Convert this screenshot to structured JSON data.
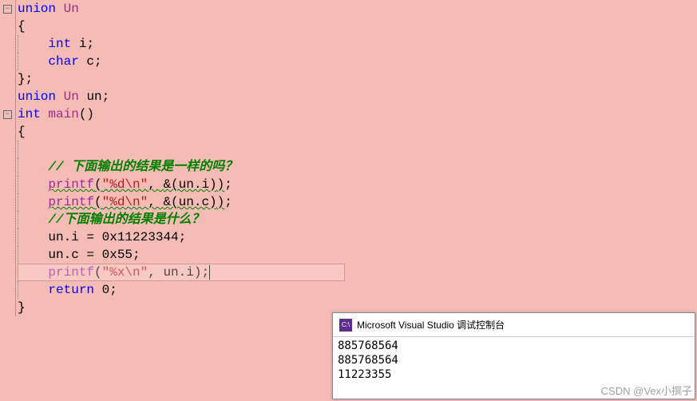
{
  "code": {
    "l1": {
      "kw1": "union",
      "id": "Un"
    },
    "l2": "{",
    "l3": {
      "kw": "int",
      "id": "i"
    },
    "l4": {
      "kw": "char",
      "id": "c"
    },
    "l5": "};",
    "l6": {
      "kw": "union",
      "ty": "Un",
      "id": "un"
    },
    "l7": {
      "kw": "int",
      "fn": "main",
      "paren": "()"
    },
    "l8": "{",
    "l9": "",
    "l10": "// 下面输出的结果是一样的吗？",
    "l11": {
      "fn": "printf",
      "str": "\"%d\\n\"",
      "expr": "&(un.i)"
    },
    "l12": {
      "fn": "printf",
      "str": "\"%d\\n\"",
      "expr": "&(un.c)"
    },
    "l13": "//下面输出的结果是什么？",
    "l14": {
      "left": "un.i",
      "val": "0x11223344"
    },
    "l15": {
      "left": "un.c",
      "val": "0x55"
    },
    "l16": {
      "fn": "printf",
      "str": "\"%x\\n\"",
      "expr": "un.i"
    },
    "l17": {
      "kw": "return",
      "val": "0"
    },
    "l18": "}"
  },
  "console": {
    "title": "Microsoft Visual Studio 调试控制台",
    "lines": [
      "885768564",
      "885768564",
      "11223355"
    ]
  },
  "fold": {
    "minus": "−"
  },
  "watermark": "CSDN @Vex小撰子"
}
